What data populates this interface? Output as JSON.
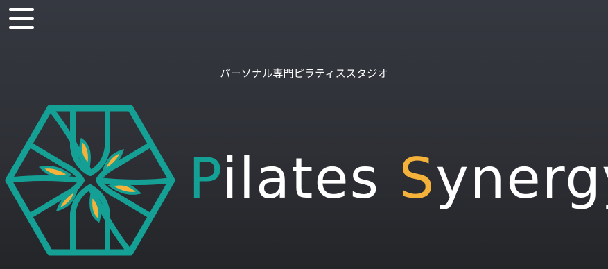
{
  "header": {
    "menu_icon": "hamburger-menu-icon"
  },
  "hero": {
    "tagline": "パーソナル専門ピラティススタジオ",
    "logo_icon": "hexagon-leaf-logo-icon",
    "brand": {
      "part1_initial": "P",
      "part1_rest": "ilates",
      "part2_initial": "S",
      "part2_rest": "ynergy"
    }
  },
  "colors": {
    "background_top": "#353840",
    "background_bottom": "#242528",
    "teal": "#15a096",
    "gold": "#f5b23a",
    "white": "#ffffff"
  }
}
